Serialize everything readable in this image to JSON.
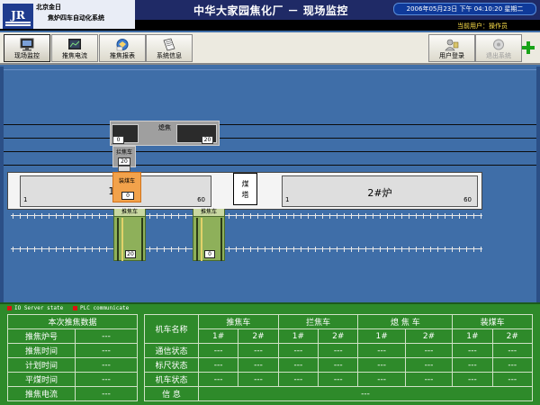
{
  "header": {
    "company": "北京金日",
    "system_name": "焦炉四车自动化系统",
    "title": "中华大家园焦化厂 － 现场监控",
    "datetime": "2006年05月23日  下午 04:10:20  星期二",
    "current_user_label": "当前用户：操作员"
  },
  "toolbar": {
    "items": [
      {
        "label": "现场监控",
        "icon": "monitor-icon"
      },
      {
        "label": "推焦电流",
        "icon": "current-chart-icon"
      },
      {
        "label": "推焦报表",
        "icon": "report-icon"
      },
      {
        "label": "系统信息",
        "icon": "info-doc-icon"
      }
    ],
    "right_items": [
      {
        "label": "用户登录",
        "icon": "user-login-icon"
      },
      {
        "label": "退出系统",
        "icon": "exit-icon"
      }
    ],
    "add_icon": "add-icon"
  },
  "scene": {
    "guide_car": {
      "label": "熄焦",
      "left_value": "0",
      "right_value": "20"
    },
    "block_car": {
      "label": "拦焦车",
      "value": "20"
    },
    "small_value": "0",
    "oven1": {
      "name": "1#",
      "start": "1",
      "end": "60"
    },
    "oven2": {
      "name": "2#炉",
      "start": "1",
      "end": "60"
    },
    "tower": "煤\n塔",
    "tower_top": "煤",
    "tower_bottom": "塔",
    "coal_car": {
      "label": "装煤车",
      "value": "0"
    },
    "pusher1": {
      "label": "推焦车",
      "value": "20"
    },
    "pusher2": {
      "label": "推焦车",
      "value": "0"
    }
  },
  "legend": {
    "io_state": "IO Server state",
    "plc_comm": "PLC communicate"
  },
  "push_data": {
    "title": "本次推焦数据",
    "rows": [
      {
        "label": "推焦炉号",
        "value": "---"
      },
      {
        "label": "推焦时间",
        "value": "---"
      },
      {
        "label": "计划时间",
        "value": "---"
      },
      {
        "label": "平煤时间",
        "value": "---"
      },
      {
        "label": "推焦电流",
        "value": "---"
      }
    ]
  },
  "status_table": {
    "name_header": "机车名称",
    "groups": [
      "推焦车",
      "拦焦车",
      "熄 焦 车",
      "装煤车"
    ],
    "sub_headers": [
      "1#",
      "2#",
      "1#",
      "2#",
      "1#",
      "2#",
      "1#",
      "2#"
    ],
    "rows": [
      {
        "label": "通信状态",
        "values": [
          "---",
          "---",
          "---",
          "---",
          "---",
          "---",
          "---",
          "---"
        ]
      },
      {
        "label": "标尺状态",
        "values": [
          "---",
          "---",
          "---",
          "---",
          "---",
          "---",
          "---",
          "---"
        ]
      },
      {
        "label": "机车状态",
        "values": [
          "---",
          "---",
          "---",
          "---",
          "---",
          "---",
          "---",
          "---"
        ]
      }
    ],
    "info_label": "信    息",
    "info_value": "---"
  },
  "colors": {
    "background": "#3f6ea8",
    "header": "#1f2a66",
    "panel": "#2e8a2a",
    "coal_car": "#f2a24b",
    "quench_car": "#8eb05a"
  }
}
